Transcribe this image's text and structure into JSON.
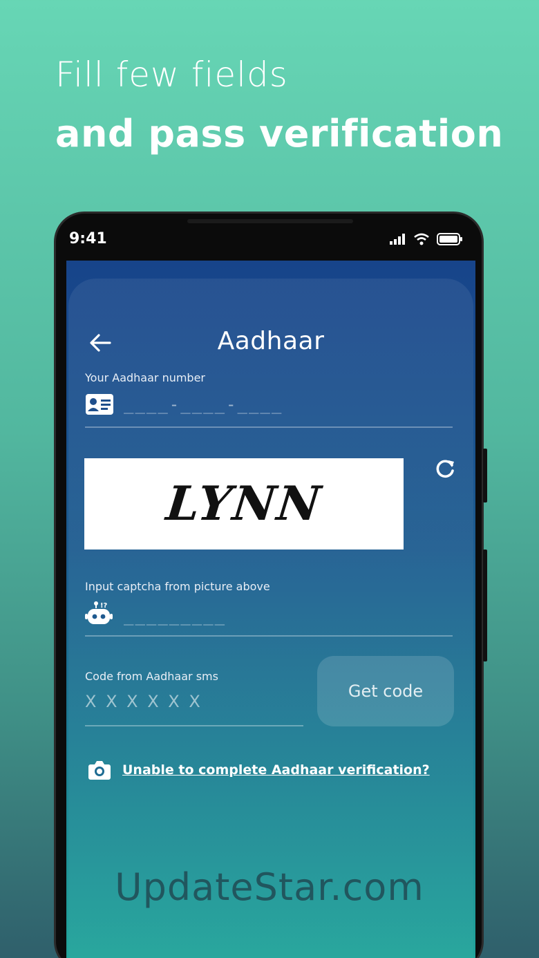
{
  "headline": {
    "line1": "Fill few fields",
    "line2": "and pass verification"
  },
  "status": {
    "time": "9:41"
  },
  "screen": {
    "title": "Aadhaar",
    "aadhaar": {
      "label": "Your Aadhaar number",
      "placeholder": "____-____-____"
    },
    "captcha": {
      "image_text": "LYNN",
      "label": "Input captcha from picture above",
      "placeholder": "_________"
    },
    "sms": {
      "label": "Code from Aadhaar sms",
      "placeholder": "X X X X X X",
      "button": "Get code"
    },
    "help_link": "Unable to complete Aadhaar verification?"
  },
  "watermark": "UpdateStar.com",
  "colors": {
    "bg_top": "#67d6b5",
    "screen_top": "#17448a",
    "screen_bottom": "#22a89b"
  }
}
